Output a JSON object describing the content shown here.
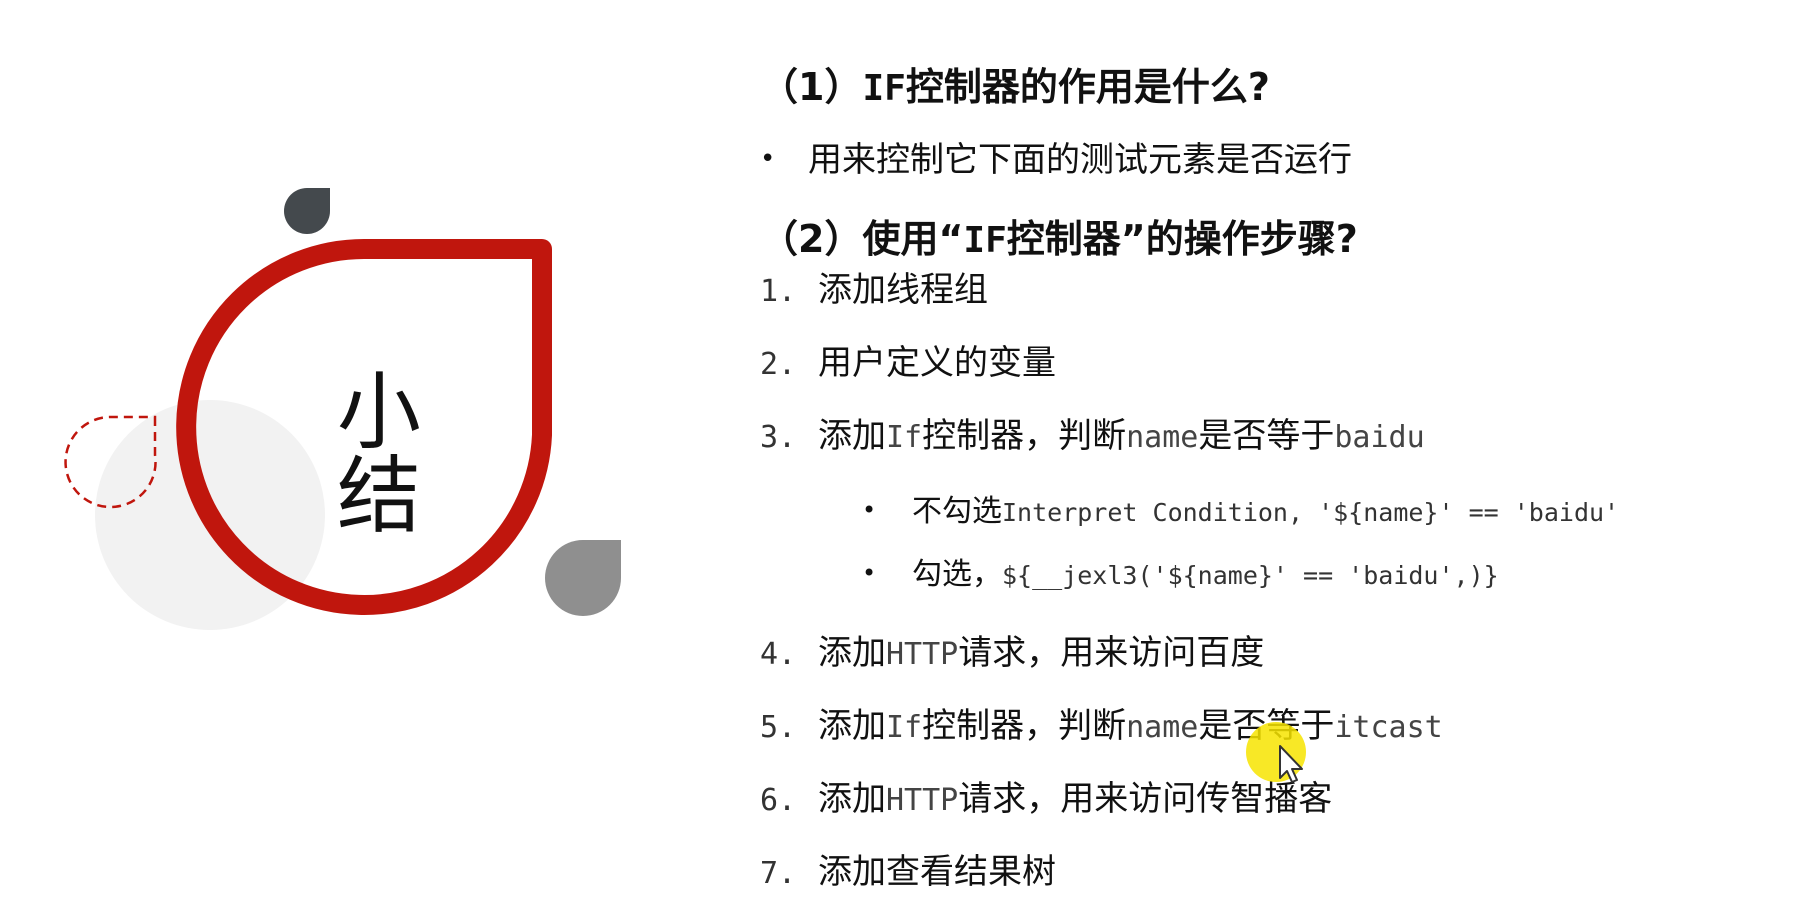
{
  "slide": {
    "title": "小结",
    "q1": {
      "prefix": "（1）",
      "code": "IF",
      "text": "控制器的作用是什么?"
    },
    "q1_answer": "用来控制它下面的测试元素是否运行",
    "q2": {
      "prefix": "（2）使用“",
      "code": "IF",
      "text": "控制器”的操作步骤?"
    },
    "steps": [
      {
        "num": "1.",
        "parts": [
          {
            "t": "添加线程组"
          }
        ]
      },
      {
        "num": "2.",
        "parts": [
          {
            "t": "用户定义的变量"
          }
        ]
      },
      {
        "num": "3.",
        "parts": [
          {
            "t": "添加"
          },
          {
            "c": "If"
          },
          {
            "t": "控制器，判断"
          },
          {
            "c": "name"
          },
          {
            "t": "是否等于"
          },
          {
            "c": "baidu"
          }
        ]
      },
      {
        "num": "4.",
        "parts": [
          {
            "t": "添加"
          },
          {
            "c": "HTTP"
          },
          {
            "t": "请求，用来访问百度"
          }
        ]
      },
      {
        "num": "5.",
        "parts": [
          {
            "t": "添加"
          },
          {
            "c": "If"
          },
          {
            "t": "控制器，判断"
          },
          {
            "c": "name"
          },
          {
            "t": "是否等于"
          },
          {
            "c": "itcast"
          }
        ]
      },
      {
        "num": "6.",
        "parts": [
          {
            "t": "添加"
          },
          {
            "c": "HTTP"
          },
          {
            "t": "请求，用来访问传智播客"
          }
        ]
      },
      {
        "num": "7.",
        "parts": [
          {
            "t": "添加查看结果树"
          }
        ]
      }
    ],
    "sub_items": [
      {
        "parts": [
          {
            "t": "不勾选"
          },
          {
            "c": "Interpret Condition, '${name}' == 'baidu'"
          }
        ]
      },
      {
        "parts": [
          {
            "t": "勾选，"
          },
          {
            "c": "${__jexl3('${name}' == 'baidu',)}"
          }
        ]
      }
    ]
  },
  "colors": {
    "accent_red": "#c0160d",
    "dark_drop": "#44494d",
    "gray_drop": "#8f8f8f",
    "light_circle": "#f2f2f2",
    "cursor_highlight": "#f7e400"
  },
  "icons": {
    "bullet": "bullet-dot",
    "cursor": "mouse-pointer-icon"
  }
}
